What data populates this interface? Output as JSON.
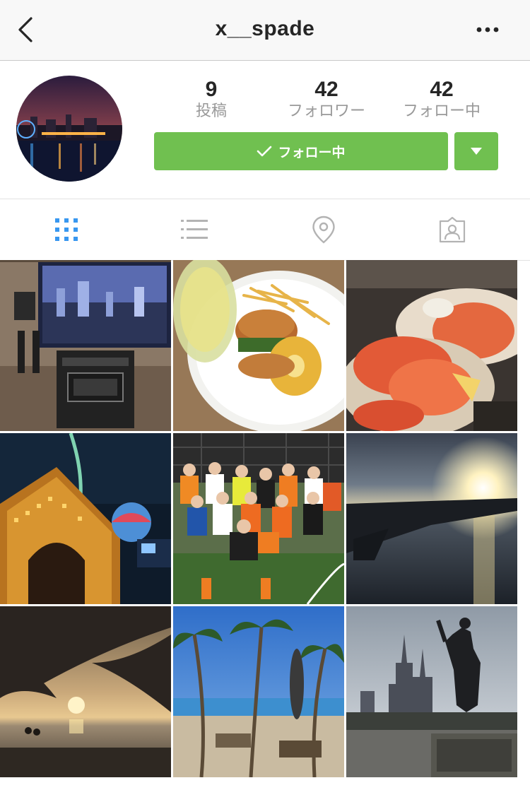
{
  "navbar": {
    "title": "x__spade",
    "back_icon": "chevron-left-icon",
    "more_icon": "more-dots-icon"
  },
  "profile": {
    "stats": [
      {
        "number": "9",
        "label": "投稿"
      },
      {
        "number": "42",
        "label": "フォロワー"
      },
      {
        "number": "42",
        "label": "フォロー中"
      }
    ],
    "follow_button": "フォロー中",
    "accent_color": "#70c050"
  },
  "tabs": [
    {
      "icon": "grid-icon",
      "active": true
    },
    {
      "icon": "list-icon",
      "active": false
    },
    {
      "icon": "location-pin-icon",
      "active": false
    },
    {
      "icon": "tagged-person-icon",
      "active": false
    }
  ],
  "posts": [
    {
      "subject": "karaoke-room"
    },
    {
      "subject": "burger-with-pineapple"
    },
    {
      "subject": "crab-dinner"
    },
    {
      "subject": "illuminated-arch-at-night"
    },
    {
      "subject": "futsal-team-photo"
    },
    {
      "subject": "sunset-from-airplane-window"
    },
    {
      "subject": "palm-tree-sunset"
    },
    {
      "subject": "beach-with-palm-trees"
    },
    {
      "subject": "castle-and-statue"
    }
  ]
}
